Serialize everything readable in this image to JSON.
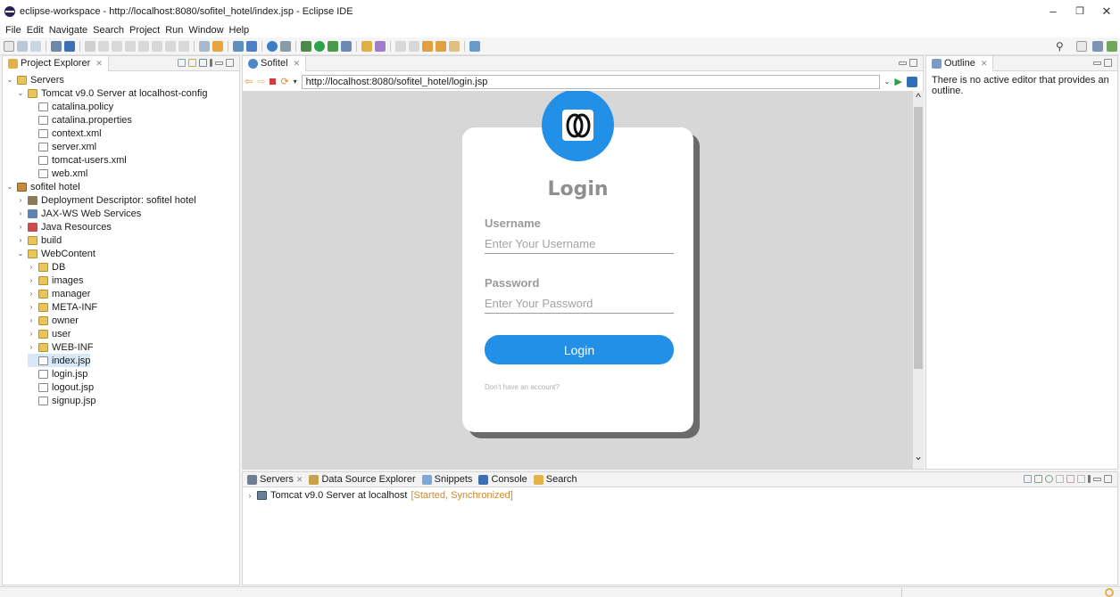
{
  "window": {
    "title": "eclipse-workspace - http://localhost:8080/sofitel_hotel/index.jsp - Eclipse IDE",
    "controls": {
      "minimize": "–",
      "maximize": "❐",
      "close": "✕"
    }
  },
  "menu": [
    "File",
    "Edit",
    "Navigate",
    "Search",
    "Project",
    "Run",
    "Window",
    "Help"
  ],
  "project_explorer": {
    "tab_label": "Project Explorer",
    "tab_close": "✕",
    "tree": [
      {
        "label": "Servers",
        "toggle": "⌄",
        "icon": "folder"
      },
      {
        "label": "Tomcat v9.0 Server at localhost-config",
        "toggle": "⌄",
        "icon": "folder"
      },
      {
        "label": "catalina.policy",
        "toggle": "",
        "icon": "file"
      },
      {
        "label": "catalina.properties",
        "toggle": "",
        "icon": "file"
      },
      {
        "label": "context.xml",
        "toggle": "",
        "icon": "xml"
      },
      {
        "label": "server.xml",
        "toggle": "",
        "icon": "xml"
      },
      {
        "label": "tomcat-users.xml",
        "toggle": "",
        "icon": "xml"
      },
      {
        "label": "web.xml",
        "toggle": "",
        "icon": "xml"
      },
      {
        "label": "sofitel hotel",
        "toggle": "⌄",
        "icon": "project"
      },
      {
        "label": "Deployment Descriptor: sofitel hotel",
        "toggle": "›",
        "icon": "dd"
      },
      {
        "label": "JAX-WS Web Services",
        "toggle": "›",
        "icon": "jaxws"
      },
      {
        "label": "Java Resources",
        "toggle": "›",
        "icon": "javares"
      },
      {
        "label": "build",
        "toggle": "›",
        "icon": "folder"
      },
      {
        "label": "WebContent",
        "toggle": "⌄",
        "icon": "folder"
      },
      {
        "label": "DB",
        "toggle": "›",
        "icon": "folder"
      },
      {
        "label": "images",
        "toggle": "›",
        "icon": "folder"
      },
      {
        "label": "manager",
        "toggle": "›",
        "icon": "folder"
      },
      {
        "label": "META-INF",
        "toggle": "›",
        "icon": "folder"
      },
      {
        "label": "owner",
        "toggle": "›",
        "icon": "folder"
      },
      {
        "label": "user",
        "toggle": "›",
        "icon": "folder"
      },
      {
        "label": "WEB-INF",
        "toggle": "›",
        "icon": "folder"
      },
      {
        "label": "index.jsp",
        "toggle": "",
        "icon": "file"
      },
      {
        "label": "login.jsp",
        "toggle": "",
        "icon": "file"
      },
      {
        "label": "logout.jsp",
        "toggle": "",
        "icon": "file"
      },
      {
        "label": "signup.jsp",
        "toggle": "",
        "icon": "file"
      }
    ]
  },
  "browser": {
    "tab_label": "Sofitel",
    "tab_close": "✕",
    "url": "http://localhost:8080/sofitel_hotel/login.jsp",
    "login": {
      "title": "Login",
      "username_label": "Username",
      "username_placeholder": "Enter Your Username",
      "password_label": "Password",
      "password_placeholder": "Enter Your Password",
      "button_label": "Login",
      "signup_text": "Don't have an account?"
    }
  },
  "outline": {
    "tab_label": "Outline",
    "tab_close": "✕",
    "message": "There is no active editor that provides an outline."
  },
  "bottom_panel": {
    "tabs": [
      "Servers",
      "Data Source Explorer",
      "Snippets",
      "Console",
      "Search"
    ],
    "server_name": "Tomcat v9.0 Server at localhost",
    "server_status": "[Started, Synchronized]"
  },
  "colors": {
    "accent_blue": "#2390e8",
    "browser_bg": "#d7d7d7",
    "status_orange": "#d08a2c"
  }
}
